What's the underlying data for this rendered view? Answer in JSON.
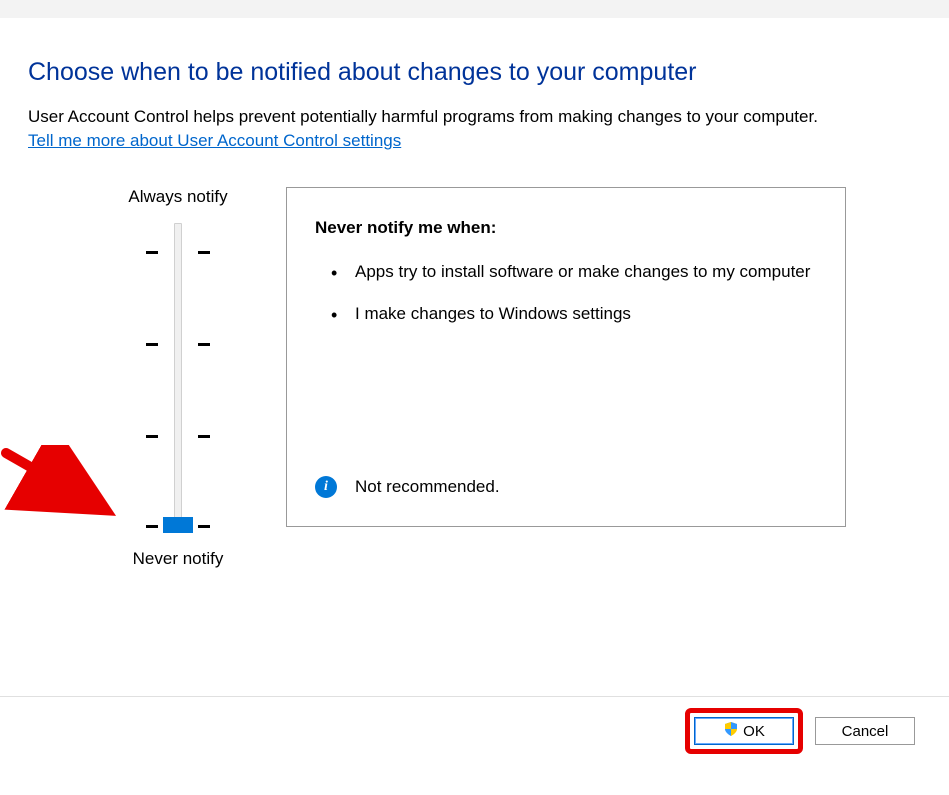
{
  "heading": "Choose when to be notified about changes to your computer",
  "description": "User Account Control helps prevent potentially harmful programs from making changes to your computer.",
  "help_link": "Tell me more about User Account Control settings",
  "slider": {
    "label_top": "Always notify",
    "label_bottom": "Never notify",
    "position": 0
  },
  "panel": {
    "title": "Never notify me when:",
    "items": [
      "Apps try to install software or make changes to my computer",
      "I make changes to Windows settings"
    ],
    "recommendation": "Not recommended."
  },
  "buttons": {
    "ok": "OK",
    "cancel": "Cancel"
  }
}
